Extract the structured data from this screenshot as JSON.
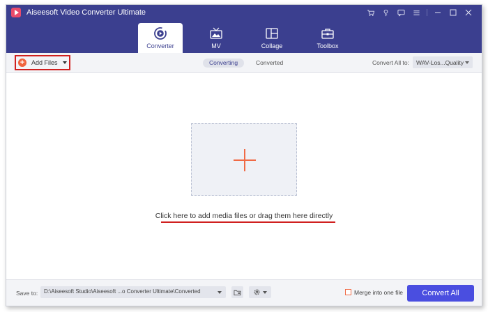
{
  "app": {
    "title": "Aiseesoft Video Converter Ultimate"
  },
  "title_icons": [
    "cart-icon",
    "key-icon",
    "chat-icon",
    "menu-icon",
    "minimize-icon",
    "maximize-icon",
    "close-icon"
  ],
  "nav": {
    "tabs": [
      {
        "label": "Converter",
        "icon": "converter-icon",
        "active": true
      },
      {
        "label": "MV",
        "icon": "mv-icon",
        "active": false
      },
      {
        "label": "Collage",
        "icon": "collage-icon",
        "active": false
      },
      {
        "label": "Toolbox",
        "icon": "toolbox-icon",
        "active": false
      }
    ]
  },
  "toolbar": {
    "add_files": "Add Files",
    "segments": [
      "Converting",
      "Converted"
    ],
    "active_segment": "Converting",
    "convert_all_to_label": "Convert All to:",
    "format_value": "WAV-Los...Quality"
  },
  "main": {
    "drop_hint": "Click here to add media files or drag them here directly"
  },
  "bottom": {
    "save_to_label": "Save to:",
    "path_value": "D:\\Aiseesoft Studio\\Aiseesoft ...o Converter Ultimate\\Converted",
    "merge_label": "Merge into one file",
    "merge_checked": false,
    "convert_all": "Convert All"
  },
  "colors": {
    "titlebar": "#3b3f8f",
    "accent": "#f06a45",
    "highlight_red": "#d0201f",
    "primary_button": "#4a4ee0"
  }
}
